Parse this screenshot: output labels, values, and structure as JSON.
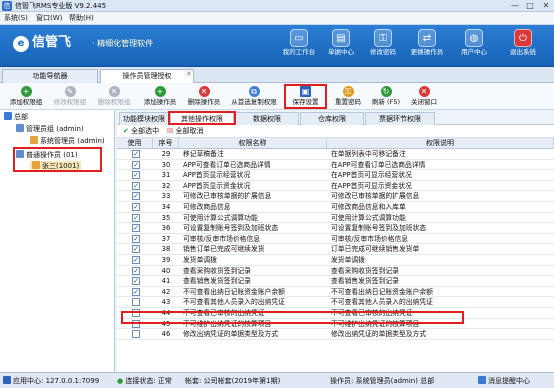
{
  "window": {
    "title": "信管飞RMS专业版 V9.2.445",
    "controls": [
      "—",
      "□",
      "✕"
    ]
  },
  "menu": [
    "系统(S)",
    "窗口(W)",
    "帮助(H)"
  ],
  "brand": {
    "name": "信管飞",
    "slogan": "· 精细化管理软件"
  },
  "nav": [
    {
      "label": "我的工作台",
      "icon": "desktop-icon"
    },
    {
      "label": "单据中心",
      "icon": "document-icon"
    },
    {
      "label": "修改密码",
      "icon": "key-icon"
    },
    {
      "label": "更换操作员",
      "icon": "user-switch-icon"
    },
    {
      "label": "用户中心",
      "icon": "globe-icon"
    },
    {
      "label": "退出系统",
      "icon": "power-icon"
    }
  ],
  "tabs": {
    "func_nav": "功能导航器",
    "perm": "操作员管理授权",
    "close": "✕"
  },
  "toolbar": {
    "add_group": "添加权限组",
    "edit_group": "修改权限组",
    "del_group": "删除权限组",
    "add_op": "添加操作员",
    "del_op": "删除操作员",
    "copy_perm": "从首选复制权限",
    "save": "保存设置",
    "reset_pwd": "重置密码",
    "refresh": "刷新 (F5)",
    "close": "关闭窗口"
  },
  "tree": {
    "root": "总部",
    "admin_group": "管理员组 (admin)",
    "admin_user": "系统管理员 (admin)",
    "normal_group": "普通操作员 (01)",
    "normal_user": "张三(1001)"
  },
  "subtabs": [
    "功能模块权限",
    "其他操作权限",
    "数据权限",
    "仓库权限",
    "票据环节权限"
  ],
  "select": {
    "all": "全部选中",
    "none": "全部取消"
  },
  "grid": {
    "headers": {
      "use": "使用",
      "seq": "序号",
      "name": "权限名称",
      "desc": "权限说明"
    },
    "rows": [
      {
        "checked": true,
        "seq": "29",
        "name": "移记草稿备注",
        "desc": "在单据列表中可移记备注"
      },
      {
        "checked": true,
        "seq": "30",
        "name": "APP可查看订单已选商品详情",
        "desc": "在APP可查看订单已选商品详情"
      },
      {
        "checked": true,
        "seq": "31",
        "name": "APP首页显示经营状况",
        "desc": "在APP首页可显示经营状况"
      },
      {
        "checked": true,
        "seq": "32",
        "name": "APP首页显示资金状况",
        "desc": "在APP首页可显示资金状况"
      },
      {
        "checked": true,
        "seq": "33",
        "name": "可修改已审核单据的扩展信息",
        "desc": "可修改已审核单据的扩展信息"
      },
      {
        "checked": true,
        "seq": "34",
        "name": "可修改商品信息",
        "desc": "可修改商品信息和入库单"
      },
      {
        "checked": true,
        "seq": "35",
        "name": "可使用计算公式调算功能",
        "desc": "可使用计算公式调算功能"
      },
      {
        "checked": true,
        "seq": "36",
        "name": "可设置复制账号签到及加班状态",
        "desc": "可设置复制账号签到及加班状态"
      },
      {
        "checked": true,
        "seq": "37",
        "name": "可审核/反审市场价格信息",
        "desc": "可审核/反审市场价格信息"
      },
      {
        "checked": true,
        "seq": "38",
        "name": "销售订单已完成可继续发货",
        "desc": "订单已完成可继续销售发货单"
      },
      {
        "checked": true,
        "seq": "39",
        "name": "发货单调拨",
        "desc": "发货单调拨"
      },
      {
        "checked": true,
        "seq": "40",
        "name": "查看采购收货签到记录",
        "desc": "查看采购收货签到记录"
      },
      {
        "checked": true,
        "seq": "41",
        "name": "查看销售发货签到记录",
        "desc": "查看销售发货签到记录"
      },
      {
        "checked": true,
        "seq": "42",
        "name": "不可查看出纳日记账资金账户余额",
        "desc": "不可查看出纳日记账资金账户余额"
      },
      {
        "checked": false,
        "seq": "43",
        "name": "不可查看其他人员录入的出纳凭证",
        "desc": "不可查看其他人员录入的出纳凭证"
      },
      {
        "checked": false,
        "seq": "44",
        "name": "不可查看已审核的出纳凭证",
        "desc": "不可查看已审核的出纳凭证"
      },
      {
        "checked": false,
        "seq": "45",
        "name": "不可维护出纳凭证的核算项目",
        "desc": "不可维护出纳凭证的核算项目"
      },
      {
        "checked": false,
        "seq": "46",
        "name": "修改出纳凭证的单据类型及方式",
        "desc": "修改出纳凭证的单据类型及方式"
      }
    ]
  },
  "status": {
    "app_center": "应用中心: 127.0.0.1:7099",
    "conn": "连接状态: 正常",
    "account": "帐套: 公司帐套(2019年第1期)",
    "operator": "操作员: 系统管理员(admin) 总部",
    "messages": "消息提醒中心"
  }
}
